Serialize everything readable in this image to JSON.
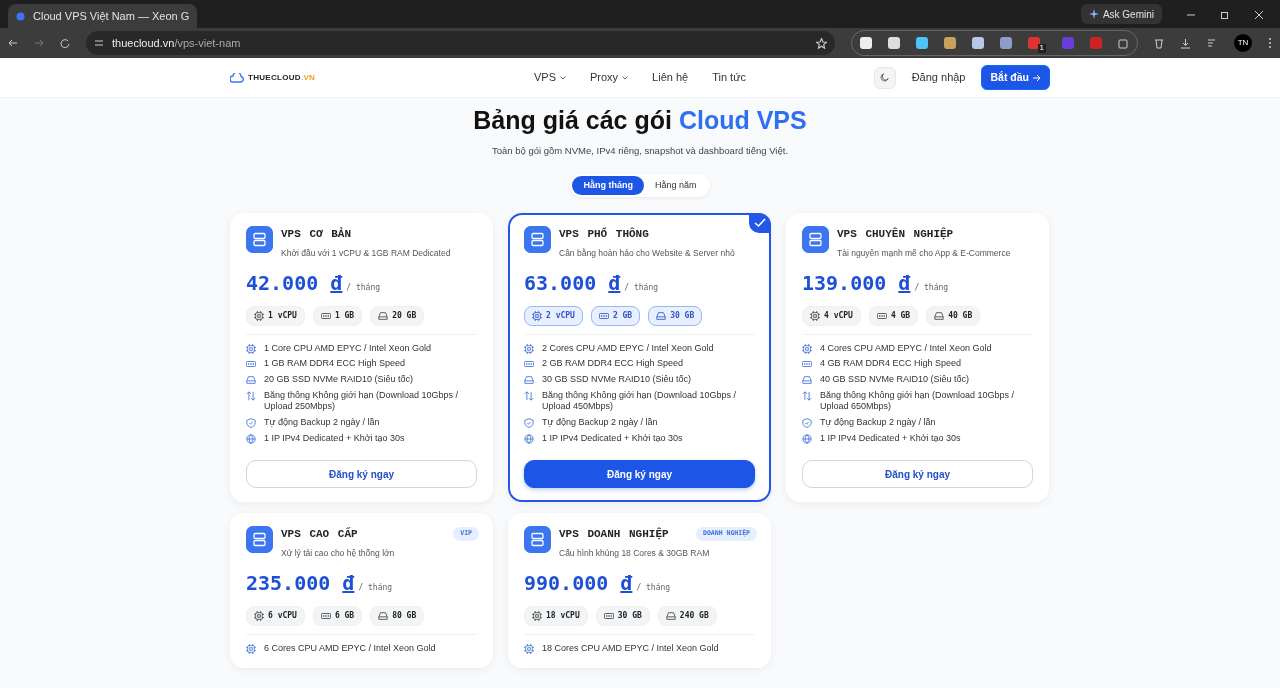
{
  "browser": {
    "tab_title": "Cloud VPS Việt Nam — Xeon G",
    "url_host": "thuecloud.vn",
    "url_path": "/vps-viet-nam",
    "ask_button": "Ask Gemini",
    "extension_badge": "1",
    "profile": "TN"
  },
  "nav": {
    "logo": "THUECLOUD",
    "logo_suffix": ".VN",
    "links": [
      {
        "label": "VPS",
        "dropdown": true
      },
      {
        "label": "Proxy",
        "dropdown": true
      },
      {
        "label": "Liên hệ",
        "dropdown": false
      },
      {
        "label": "Tin tức",
        "dropdown": false
      }
    ],
    "login": "Đăng nhập",
    "start": "Bắt đầu"
  },
  "hero": {
    "title": "Bảng giá các gói",
    "title_accent": "Cloud VPS",
    "subtitle": "Toàn bộ gói gồm NVMe, IPv4 riêng, snapshot và dashboard tiếng Việt."
  },
  "billing_tabs": [
    {
      "label": "Hằng tháng",
      "selected": true
    },
    {
      "label": "Hằng năm",
      "selected": false
    }
  ],
  "plans": [
    {
      "name": "VPS CƠ BẢN",
      "tagline": "Khởi đầu với 1 vCPU & 1GB RAM Dedicated",
      "price": "42.000",
      "currency": "đ",
      "period": "/ tháng",
      "selected": false,
      "specs": [
        {
          "kind": "cpu",
          "text": "1 vCPU"
        },
        {
          "kind": "ram",
          "text": "1 GB"
        },
        {
          "kind": "disk",
          "text": "20 GB"
        }
      ],
      "features": [
        {
          "kind": "cpu",
          "text": "1 Core CPU AMD EPYC / Intel Xeon Gold"
        },
        {
          "kind": "ram",
          "text": "1 GB RAM DDR4 ECC High Speed"
        },
        {
          "kind": "disk",
          "text": "20 GB SSD NVMe RAID10 (Siêu tốc)"
        },
        {
          "kind": "bandwidth",
          "text": "Băng thông Không giới hạn (Download 10Gbps / Upload 250Mbps)"
        },
        {
          "kind": "backup",
          "text": "Tự động Backup 2 ngày / lần"
        },
        {
          "kind": "ip",
          "text": "1 IP IPv4 Dedicated + Khởi tạo 30s"
        }
      ],
      "button": "Đăng ký ngay"
    },
    {
      "name": "VPS PHỔ THÔNG",
      "tagline": "Cân bằng hoàn hảo cho Website & Server nhỏ",
      "price": "63.000",
      "currency": "đ",
      "period": "/ tháng",
      "selected": true,
      "specs": [
        {
          "kind": "cpu",
          "text": "2 vCPU"
        },
        {
          "kind": "ram",
          "text": "2 GB"
        },
        {
          "kind": "disk",
          "text": "30 GB"
        }
      ],
      "features": [
        {
          "kind": "cpu",
          "text": "2 Cores CPU AMD EPYC / Intel Xeon Gold"
        },
        {
          "kind": "ram",
          "text": "2 GB RAM DDR4 ECC High Speed"
        },
        {
          "kind": "disk",
          "text": "30 GB SSD NVMe RAID10 (Siêu tốc)"
        },
        {
          "kind": "bandwidth",
          "text": "Băng thông Không giới hạn (Download 10Gbps / Upload 450Mbps)"
        },
        {
          "kind": "backup",
          "text": "Tự động Backup 2 ngày / lần"
        },
        {
          "kind": "ip",
          "text": "1 IP IPv4 Dedicated + Khởi tạo 30s"
        }
      ],
      "button": "Đăng ký ngay"
    },
    {
      "name": "VPS CHUYÊN NGHIỆP",
      "tagline": "Tài nguyên mạnh mẽ cho App & E-Commerce",
      "price": "139.000",
      "currency": "đ",
      "period": "/ tháng",
      "selected": false,
      "specs": [
        {
          "kind": "cpu",
          "text": "4 vCPU"
        },
        {
          "kind": "ram",
          "text": "4 GB"
        },
        {
          "kind": "disk",
          "text": "40 GB"
        }
      ],
      "features": [
        {
          "kind": "cpu",
          "text": "4 Cores CPU AMD EPYC / Intel Xeon Gold"
        },
        {
          "kind": "ram",
          "text": "4 GB RAM DDR4 ECC High Speed"
        },
        {
          "kind": "disk",
          "text": "40 GB SSD NVMe RAID10 (Siêu tốc)"
        },
        {
          "kind": "bandwidth",
          "text": "Băng thông Không giới hạn (Download 10Gbps / Upload 650Mbps)"
        },
        {
          "kind": "backup",
          "text": "Tự động Backup 2 ngày / lần"
        },
        {
          "kind": "ip",
          "text": "1 IP IPv4 Dedicated + Khởi tạo 30s"
        }
      ],
      "button": "Đăng ký ngay"
    },
    {
      "name": "VPS CAO CẤP",
      "tagline": "Xử lý tải cao cho hệ thống lớn",
      "badge": "VIP",
      "price": "235.000",
      "currency": "đ",
      "period": "/ tháng",
      "selected": false,
      "specs": [
        {
          "kind": "cpu",
          "text": "6 vCPU"
        },
        {
          "kind": "ram",
          "text": "6 GB"
        },
        {
          "kind": "disk",
          "text": "80 GB"
        }
      ],
      "features": [
        {
          "kind": "cpu",
          "text": "6 Cores CPU AMD EPYC / Intel Xeon Gold"
        }
      ]
    },
    {
      "name": "VPS DOANH NGHIỆP",
      "tagline": "Cấu hình khủng 18 Cores & 30GB RAM",
      "badge": "DOANH NGHIỆP",
      "price": "990.000",
      "currency": "đ",
      "period": "/ tháng",
      "selected": false,
      "specs": [
        {
          "kind": "cpu",
          "text": "18 vCPU"
        },
        {
          "kind": "ram",
          "text": "30 GB"
        },
        {
          "kind": "disk",
          "text": "240 GB"
        }
      ],
      "features": [
        {
          "kind": "cpu",
          "text": "18 Cores CPU AMD EPYC / Intel Xeon Gold"
        }
      ]
    }
  ]
}
